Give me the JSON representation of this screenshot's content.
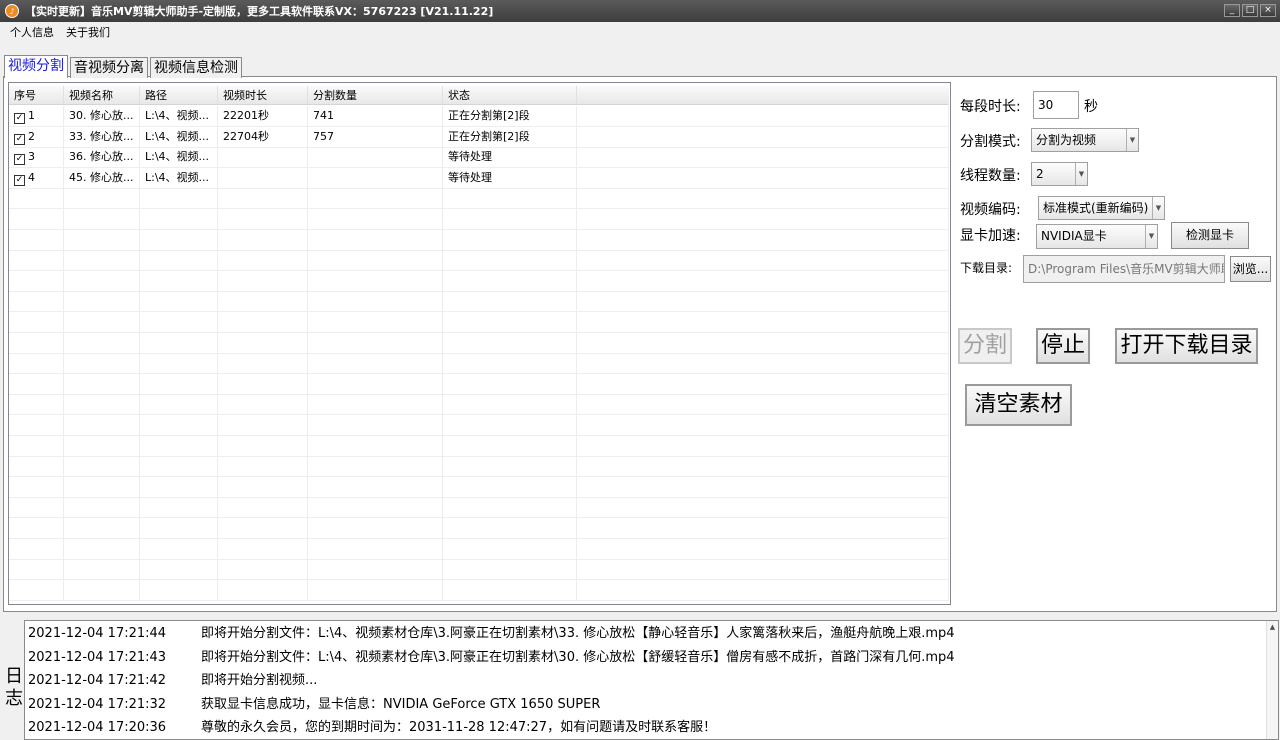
{
  "window": {
    "title": "【实时更新】音乐MV剪辑大师助手-定制版，更多工具软件联系VX：5767223 [V21.11.22]",
    "controls": [
      "_",
      "□",
      "×"
    ]
  },
  "menu": {
    "items": [
      "个人信息",
      "关于我们"
    ]
  },
  "tabs": [
    "视频分割",
    "音视频分离",
    "视频信息检测"
  ],
  "grid": {
    "columns": [
      "序号",
      "视频名称",
      "路径",
      "视频时长",
      "分割数量",
      "状态"
    ],
    "rows": [
      {
        "id": "1",
        "name": "30. 修心放...",
        "path": "L:\\4、视频...",
        "duration": "22201秒",
        "count": "741",
        "status": "正在分割第[2]段"
      },
      {
        "id": "2",
        "name": "33. 修心放...",
        "path": "L:\\4、视频...",
        "duration": "22704秒",
        "count": "757",
        "status": "正在分割第[2]段"
      },
      {
        "id": "3",
        "name": "36. 修心放...",
        "path": "L:\\4、视频...",
        "duration": "",
        "count": "",
        "status": "等待处理"
      },
      {
        "id": "4",
        "name": "45. 修心放...",
        "path": "L:\\4、视频...",
        "duration": "",
        "count": "",
        "status": "等待处理"
      }
    ]
  },
  "settings": {
    "segment_label": "每段时长:",
    "segment_value": "30",
    "segment_unit": "秒",
    "mode_label": "分割模式:",
    "mode_value": "分割为视频",
    "threads_label": "线程数量:",
    "threads_value": "2",
    "codec_label": "视频编码:",
    "codec_value": "标准模式(重新编码)",
    "gpu_label": "显卡加速:",
    "gpu_value": "NVIDIA显卡",
    "detect_gpu_button": "检测显卡",
    "download_dir_label": "下载目录:",
    "download_dir_value": "D:\\Program Files\\音乐MV剪辑大师助",
    "browse_button": "浏览..."
  },
  "actions": {
    "split": "分割",
    "stop": "停止",
    "open_dir": "打开下载目录",
    "clear": "清空素材"
  },
  "log": {
    "label": "日志",
    "entries": [
      {
        "time": "2021-12-04 17:21:44",
        "text": "即将开始分割文件：L:\\4、视频素材仓库\\3.阿豪正在切割素材\\33. 修心放松【静心轻音乐】人家篱落秋来后，渔艇舟航晚上艰.mp4"
      },
      {
        "time": "2021-12-04 17:21:43",
        "text": "即将开始分割文件：L:\\4、视频素材仓库\\3.阿豪正在切割素材\\30. 修心放松【舒缓轻音乐】僧房有感不成折，首路门深有几何.mp4"
      },
      {
        "time": "2021-12-04 17:21:42",
        "text": "即将开始分割视频..."
      },
      {
        "time": "2021-12-04 17:21:32",
        "text": "获取显卡信息成功，显卡信息：NVIDIA GeForce GTX 1650 SUPER"
      },
      {
        "time": "2021-12-04 17:20:36",
        "text": "尊敬的永久会员，您的到期时间为：2031-11-28 12:47:27，如有问题请及时联系客服！"
      }
    ]
  }
}
